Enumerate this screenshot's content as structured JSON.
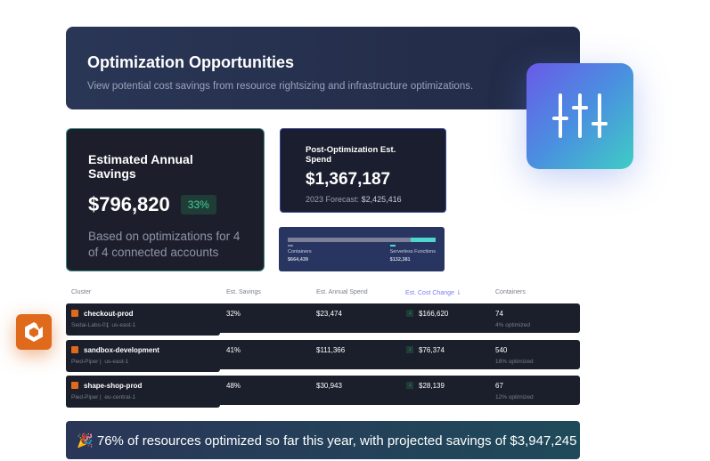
{
  "header": {
    "title": "Optimization Opportunities",
    "subtitle": "View potential cost savings from resource rightsizing and infrastructure optimizations."
  },
  "savings": {
    "title": "Estimated Annual Savings",
    "value": "$796,820",
    "percent": "33%",
    "description": "Based on optimizations for 4 of 4 connected accounts"
  },
  "post": {
    "title": "Post-Optimization Est. Spend",
    "value": "$1,367,187",
    "forecast_label": "2023 Forecast:",
    "forecast_value": "$2,425,416"
  },
  "breakdown": {
    "items": [
      {
        "label": "Containers",
        "value": "$664,439",
        "share": 0.83,
        "color": "#7c8199"
      },
      {
        "label": "Serverless Functions",
        "value": "$132,381",
        "share": 0.17,
        "color": "#4fd6cf"
      }
    ]
  },
  "table": {
    "headers": [
      "Cluster",
      "Est. Savings",
      "Est. Annual Spend",
      "Est. Cost Change",
      "Containers"
    ],
    "rows": [
      {
        "name": "checkout-prod",
        "account": "Sedai-Labs-01",
        "region": "us-east-1",
        "savings": "32%",
        "spend": "$23,474",
        "change": "$166,620",
        "containers": "74",
        "optimized": "4% optimized"
      },
      {
        "name": "sandbox-development",
        "account": "Pied-Piper",
        "region": "us-east-1",
        "savings": "41%",
        "spend": "$111,366",
        "change": "$76,374",
        "containers": "540",
        "optimized": "18% optimized"
      },
      {
        "name": "shape-shop-prod",
        "account": "Pied-Piper",
        "region": "eu-central-1",
        "savings": "48%",
        "spend": "$30,943",
        "change": "$28,139",
        "containers": "67",
        "optimized": "12% optimized"
      }
    ]
  },
  "banner": {
    "emoji": "🎉",
    "text": "76% of resources optimized so far this year, with projected savings of $3,947,245"
  },
  "colors": {
    "accent": "#7b7cf0",
    "green": "#3fd49a",
    "orange": "#e06a1c"
  }
}
